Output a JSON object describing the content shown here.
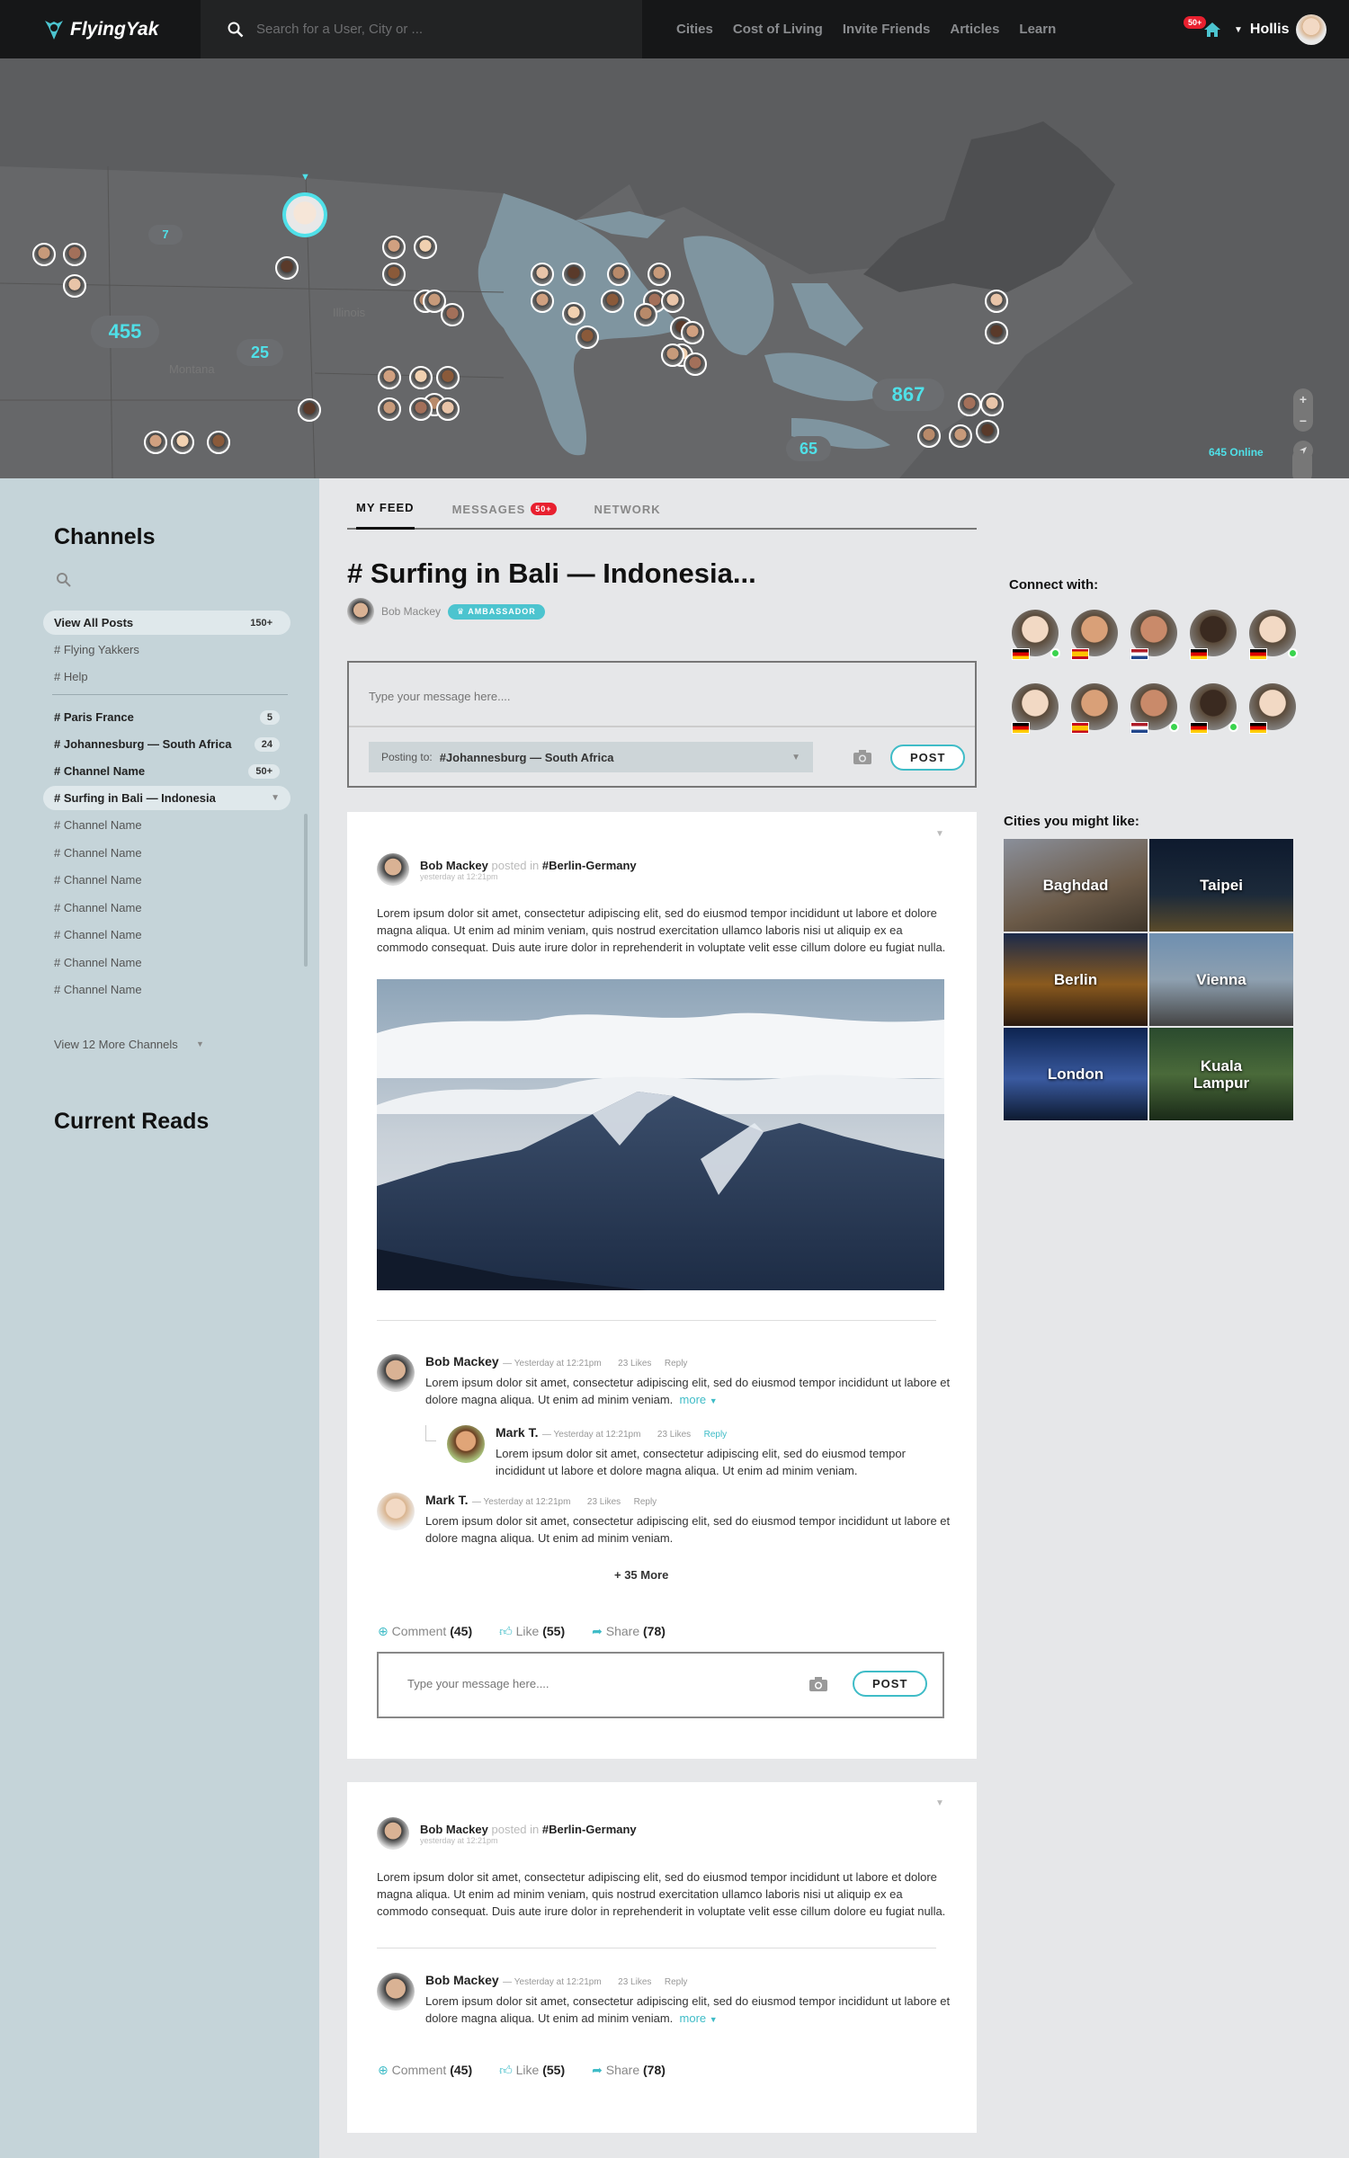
{
  "header": {
    "logo_text": "FlyingYak",
    "search_placeholder": "Search for a User, City or ...",
    "nav": [
      "Cities",
      "Cost of Living",
      "Invite Friends",
      "Articles",
      "Learn"
    ],
    "notif_count": "50+",
    "user_name": "Hollis"
  },
  "map": {
    "clusters": [
      "7",
      "455",
      "25",
      "867",
      "65"
    ],
    "labels": [
      "Illinois",
      "Montana"
    ],
    "online": "645 Online",
    "zoom_in": "+",
    "zoom_out": "−"
  },
  "sidebar": {
    "channels_title": "Channels",
    "view_all": {
      "label": "View All Posts",
      "count": "150+"
    },
    "static": [
      "# Flying Yakkers",
      "# Help"
    ],
    "channels": [
      {
        "label": "# Paris France",
        "count": "5"
      },
      {
        "label": "# Johannesburg — South Africa",
        "count": "24"
      },
      {
        "label": "# Channel Name",
        "count": "50+"
      },
      {
        "label": "# Surfing in Bali — Indonesia",
        "count": ""
      }
    ],
    "plain": [
      "# Channel Name",
      "# Channel Name",
      "# Channel Name",
      "# Channel Name",
      "# Channel Name",
      "# Channel Name",
      "# Channel Name"
    ],
    "more": "View 12 More Channels",
    "reads_title": "Current Reads"
  },
  "tabs": {
    "feed": "MY FEED",
    "messages": "MESSAGES",
    "messages_badge": "50+",
    "network": "NETWORK"
  },
  "channel": {
    "title": "# Surfing in Bali — Indonesia...",
    "owner": "Bob Mackey",
    "badge": "AMBASSADOR"
  },
  "composer": {
    "placeholder": "Type your message here....",
    "posting_label": "Posting to:",
    "posting_value": "#Johannesburg — South Africa",
    "post": "POST"
  },
  "post1": {
    "author": "Bob Mackey",
    "posted_in": "posted in",
    "channel": "#Berlin-Germany",
    "time": "yesterday at 12:21pm",
    "text": "Lorem ipsum dolor sit amet, consectetur adipiscing elit, sed do eiusmod tempor incididunt ut labore et dolore magna aliqua. Ut enim ad minim veniam, quis nostrud exercitation ullamco laboris nisi ut aliquip ex ea commodo consequat. Duis aute irure dolor in reprehenderit in voluptate velit esse cillum dolore eu fugiat nulla.",
    "comments": [
      {
        "name": "Bob Mackey",
        "meta": "— Yesterday at 12:21pm",
        "likes": "23 Likes",
        "reply": "Reply",
        "text": "Lorem ipsum dolor sit amet, consectetur adipiscing elit, sed do eiusmod tempor incididunt ut labore et dolore magna aliqua. Ut enim ad minim veniam.",
        "more": "more"
      },
      {
        "name": "Mark T.",
        "meta": "— Yesterday at 12:21pm",
        "likes": "23 Likes",
        "reply": "Reply",
        "text": "Lorem ipsum dolor sit amet, consectetur adipiscing elit, sed do eiusmod tempor incididunt ut labore et dolore magna aliqua. Ut enim ad minim veniam."
      },
      {
        "name": "Mark T.",
        "meta": "— Yesterday at 12:21pm",
        "likes": "23 Likes",
        "reply": "Reply",
        "text": "Lorem ipsum dolor sit amet, consectetur adipiscing elit, sed do eiusmod tempor incididunt ut labore et dolore magna aliqua. Ut enim ad minim veniam."
      }
    ],
    "more_comments": "+ 35 More",
    "actions": {
      "comment": "Comment",
      "comment_n": "(45)",
      "like": "Like",
      "like_n": "(55)",
      "share": "Share",
      "share_n": "(78)"
    },
    "reply_placeholder": "Type your message here...."
  },
  "post2": {
    "author": "Bob Mackey",
    "posted_in": "posted in",
    "channel": "#Berlin-Germany",
    "time": "yesterday at 12:21pm",
    "text": "Lorem ipsum dolor sit amet, consectetur adipiscing elit, sed do eiusmod tempor incididunt ut labore et dolore magna aliqua. Ut enim ad minim veniam, quis nostrud exercitation ullamco laboris nisi ut aliquip ex ea commodo consequat. Duis aute irure dolor in reprehenderit in voluptate velit esse cillum dolore eu fugiat nulla.",
    "comment": {
      "name": "Bob Mackey",
      "meta": "— Yesterday at 12:21pm",
      "likes": "23 Likes",
      "reply": "Reply",
      "text": "Lorem ipsum dolor sit amet, consectetur adipiscing elit, sed do eiusmod tempor incididunt ut labore et dolore magna aliqua. Ut enim ad minim veniam.",
      "more": "more"
    },
    "actions": {
      "comment": "Comment",
      "comment_n": "(45)",
      "like": "Like",
      "like_n": "(55)",
      "share": "Share",
      "share_n": "(78)"
    }
  },
  "right": {
    "connect_title": "Connect with:",
    "cities_title": "Cities you might like:",
    "cities": [
      "Baghdad",
      "Taipei",
      "Berlin",
      "Vienna",
      "London",
      "Kuala Lampur"
    ]
  },
  "colors": {
    "accent": "#4cc4cf",
    "badge": "#e8202f",
    "topbar": "#161718",
    "sidebar": "#c5d4d9"
  }
}
